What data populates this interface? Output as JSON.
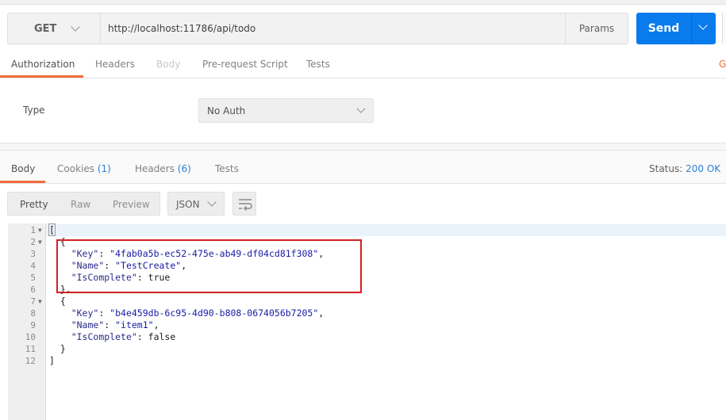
{
  "request": {
    "method": "GET",
    "url": "http://localhost:11786/api/todo",
    "params_label": "Params",
    "send_label": "Send"
  },
  "request_tabs": [
    {
      "label": "Authorization",
      "state": "active"
    },
    {
      "label": "Headers",
      "state": "normal"
    },
    {
      "label": "Body",
      "state": "disabled"
    },
    {
      "label": "Pre-request Script",
      "state": "normal"
    },
    {
      "label": "Tests",
      "state": "normal"
    }
  ],
  "edge_text": "G",
  "auth": {
    "type_label": "Type",
    "selected": "No Auth"
  },
  "response_tabs": {
    "body": "Body",
    "cookies": "Cookies",
    "cookies_count": "(1)",
    "headers": "Headers",
    "headers_count": "(6)",
    "tests": "Tests"
  },
  "status": {
    "label": "Status:",
    "value": "200 OK"
  },
  "view_modes": [
    "Pretty",
    "Raw",
    "Preview"
  ],
  "format": "JSON",
  "line_numbers": [
    "1",
    "2",
    "3",
    "4",
    "5",
    "6",
    "7",
    "8",
    "9",
    "10",
    "11",
    "12"
  ],
  "code": {
    "l1": "[",
    "l2": "{",
    "l3_key": "\"Key\"",
    "l3_val": "\"4fab0a5b-ec52-475e-ab49-df04cd81f308\"",
    "l4_key": "\"Name\"",
    "l4_val": "\"TestCreate\"",
    "l5_key": "\"IsComplete\"",
    "l5_val": "true",
    "l6": "},",
    "l7": "{",
    "l8_key": "\"Key\"",
    "l8_val": "\"b4e459db-6c95-4d90-b808-0674056b7205\"",
    "l9_key": "\"Name\"",
    "l9_val": "\"item1\"",
    "l10_key": "\"IsComplete\"",
    "l10_val": "false",
    "l11": "}",
    "l12": "]"
  },
  "colors": {
    "accent_orange": "#f26b3a",
    "send_blue": "#097bed",
    "annotation_red": "#d32121"
  }
}
